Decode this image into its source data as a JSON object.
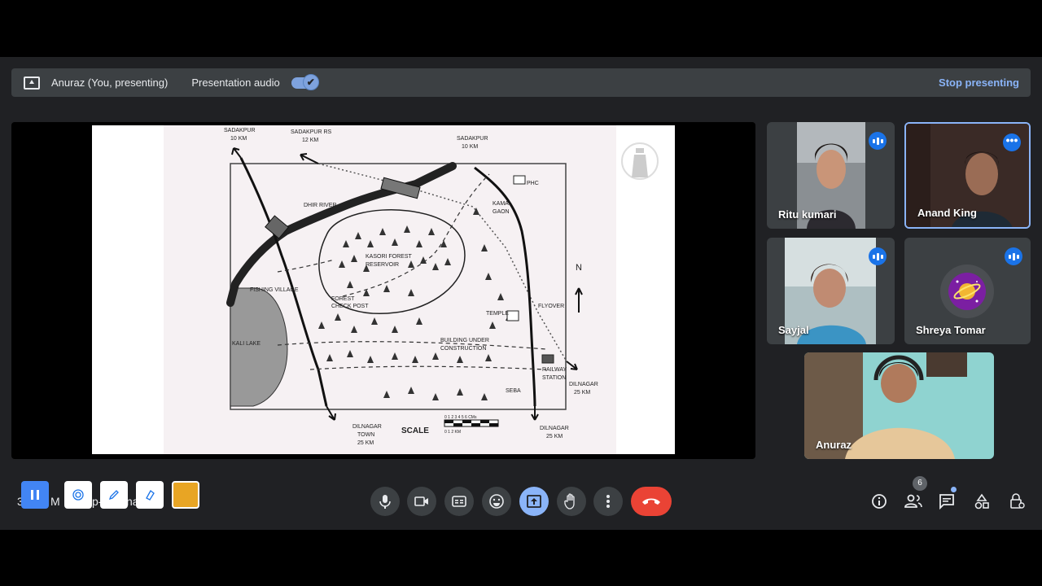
{
  "present_bar": {
    "presenting_label": "Anuraz (You, presenting)",
    "audio_label": "Presentation audio",
    "toggle_check": "✔",
    "stop_label": "Stop presenting"
  },
  "map": {
    "labels": {
      "sadakpur_left": "SADAKPUR",
      "sadakpur_left_km": "10 KM",
      "sadakpur_rs": "SADAKPUR RS",
      "sadakpur_rs_km": "12 KM",
      "sadakpur_right": "SADAKPUR",
      "sadakpur_right_km": "10 KM",
      "phc": "PHC",
      "kamal": "KAMAL",
      "gaon": "GAON",
      "dhir_river": "DHIR RIVER",
      "kasori": "KASORI FOREST",
      "reservoir": "RESERVOIR",
      "north": "N",
      "fishing_village": "FISHING VILLAGE",
      "forest": "FOREST",
      "check_post": "CHECK POST",
      "temple": "TEMPLE",
      "flyover": "FLYOVER",
      "kali_lake": "KALI LAKE",
      "building_under": "BUILDING UNDER",
      "construction": "CONSTRUCTION",
      "railway": "RAILWAY",
      "station": "STATION",
      "dilnagar_right": "DILNAGAR",
      "dilnagar_right_km": "25 KM",
      "seba": "SEBA",
      "dilnagar_town": "DILNAGAR",
      "town": "TOWN",
      "town_km": "25 KM",
      "scale": "SCALE",
      "scale_ticks": "0 1 2 3 4 5 6 CMs",
      "scale_km": "0 1 2 KM",
      "dilnagar_bottom": "DILNAGAR",
      "dilnagar_bottom_km": "25 KM"
    }
  },
  "participants": [
    {
      "name": "Ritu kumari",
      "badge": "audio"
    },
    {
      "name": "Anand King",
      "badge": "more"
    },
    {
      "name": "Sayjal",
      "badge": "audio"
    },
    {
      "name": "Shreya Tomar",
      "badge": "audio"
    },
    {
      "name": "Anuraz",
      "badge": "none"
    }
  ],
  "participant_count": "6",
  "partial_texts": {
    "a": "3",
    "b": "M",
    "c": "p-",
    "d": "na"
  },
  "colors": {
    "accent": "#8ab4f8",
    "active_tile_border": "#8ab4f8",
    "end_call": "#ea4335",
    "badge_blue": "#1a73e8",
    "swatch": "#e8a524"
  },
  "icons": [
    "present-icon",
    "mic-icon",
    "camera-icon",
    "captions-icon",
    "emoji-icon",
    "present-now-icon",
    "raise-hand-icon",
    "more-options-icon",
    "end-call-icon",
    "info-icon",
    "people-icon",
    "chat-icon",
    "activities-icon",
    "host-controls-icon",
    "pause-icon",
    "fingerprint-icon",
    "pen-icon",
    "eraser-icon"
  ]
}
